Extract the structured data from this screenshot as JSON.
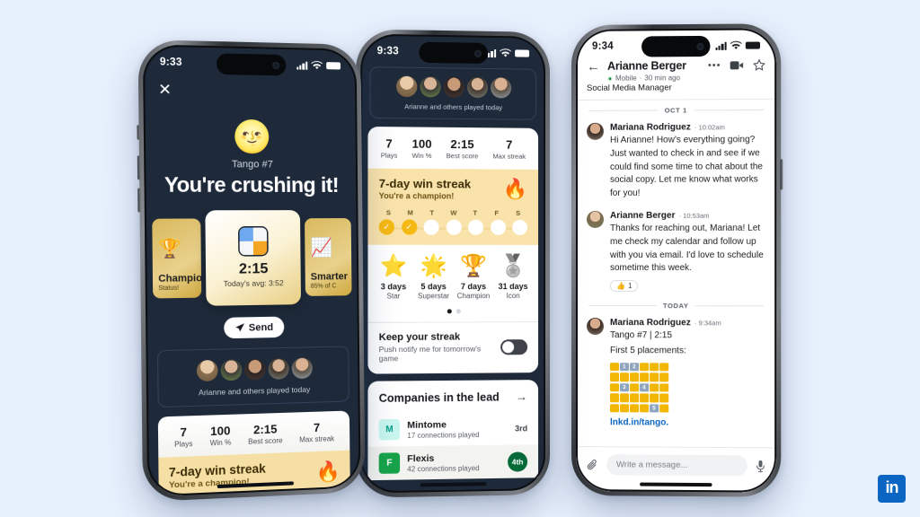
{
  "background_color": "#e7f0fd",
  "brand": {
    "logo_text": "in",
    "logo_color": "#0a66c2"
  },
  "phone1": {
    "status": {
      "time": "9:33",
      "signal_icon": "cellular-bars-icon",
      "wifi_icon": "wifi-icon",
      "battery_icon": "battery-icon"
    },
    "close_icon": "close-icon",
    "hero": {
      "emoji": "🌝",
      "subtitle": "Tango #7",
      "title": "You're crushing it!"
    },
    "cards": [
      {
        "icon": "🏆",
        "title": "Champion",
        "subtitle": "Status!"
      },
      {
        "icon": "tango-grid-icon",
        "value": "2:15",
        "subtitle": "Today's avg: 3:52"
      },
      {
        "icon": "📈",
        "title": "Smarter",
        "subtitle": "85% of C"
      }
    ],
    "send_button": {
      "label": "Send",
      "icon": "send-icon"
    },
    "friends": {
      "caption": "Arianne and others played today",
      "avatar_count": 5
    },
    "stats": [
      {
        "value": "7",
        "label": "Plays"
      },
      {
        "value": "100",
        "label": "Win %"
      },
      {
        "value": "2:15",
        "label": "Best score"
      },
      {
        "value": "7",
        "label": "Max streak"
      }
    ],
    "streak": {
      "title": "7-day win streak",
      "subtitle": "You're a champion!",
      "icon": "flame-icon"
    }
  },
  "phone2": {
    "status": {
      "time": "9:33"
    },
    "friends": {
      "caption": "Arianne and others played today",
      "avatar_count": 5
    },
    "stats": [
      {
        "value": "7",
        "label": "Plays"
      },
      {
        "value": "100",
        "label": "Win %"
      },
      {
        "value": "2:15",
        "label": "Best score"
      },
      {
        "value": "7",
        "label": "Max streak"
      }
    ],
    "streak": {
      "title": "7-day win streak",
      "subtitle": "You're a champion!",
      "icon": "flame-icon",
      "days": [
        {
          "label": "S",
          "done": true
        },
        {
          "label": "M",
          "done": true
        },
        {
          "label": "T",
          "done": false
        },
        {
          "label": "W",
          "done": false
        },
        {
          "label": "T",
          "done": false
        },
        {
          "label": "F",
          "done": false
        },
        {
          "label": "S",
          "done": false
        }
      ]
    },
    "badges": [
      {
        "icon": "⭐",
        "days": "3 days",
        "name": "Star"
      },
      {
        "icon": "🌟",
        "days": "5 days",
        "name": "Superstar"
      },
      {
        "icon": "🏆",
        "days": "7 days",
        "name": "Champion"
      },
      {
        "icon": "🏅",
        "days": "31 days",
        "name": "Icon"
      }
    ],
    "pager": {
      "pages": 2,
      "active": 0
    },
    "notify": {
      "title": "Keep your streak",
      "subtitle": "Push notify me for tomorrow's game",
      "toggle_state": "off"
    },
    "leaderboard": {
      "title": "Companies in the lead",
      "arrow_icon": "arrow-right-icon",
      "rows": [
        {
          "logo_text": "M",
          "logo_color": "#c9f7ef",
          "name": "Mintome",
          "sub": "17 connections played",
          "rank": "3rd"
        },
        {
          "logo_text": "F",
          "logo_color": "#17a34a",
          "name": "Flexis",
          "sub": "42 connections played",
          "rank": "4th"
        }
      ]
    }
  },
  "phone3": {
    "status": {
      "time": "9:34"
    },
    "header": {
      "back_icon": "back-arrow-icon",
      "name": "Arianne Berger",
      "presence": "Mobile",
      "last_seen": "30 min ago",
      "role": "Social Media Manager",
      "more_icon": "more-horizontal-icon",
      "video_icon": "video-camera-icon",
      "star_icon": "star-outline-icon"
    },
    "separators": {
      "first": "OCT 1",
      "second": "TODAY"
    },
    "messages": [
      {
        "sender": "Mariana Rodriguez",
        "time": "10:02am",
        "text": "Hi Arianne! How's everything going? Just wanted to check in and see if we could find some time to chat about the social copy. Let me know what works for you!"
      },
      {
        "sender": "Arianne Berger",
        "time": "10:53am",
        "text": "Thanks for reaching out, Mariana! Let me check my calendar and follow up with you via email. I'd love to schedule sometime this week.",
        "reaction": {
          "emoji": "👍",
          "count": "1"
        }
      },
      {
        "sender": "Mariana Rodriguez",
        "time": "9:34am",
        "line1": "Tango #7 | 2:15",
        "line2": "First 5 placements:",
        "link": "lnkd.in/tango."
      }
    ],
    "tango_grid": {
      "rows": 5,
      "cols": 6,
      "fill_color": "#f2b705",
      "marker_color": "#8fa5bd",
      "markers": [
        {
          "row": 0,
          "col": 1,
          "label": "1"
        },
        {
          "row": 0,
          "col": 2,
          "label": "2"
        },
        {
          "row": 2,
          "col": 1,
          "label": "3"
        },
        {
          "row": 2,
          "col": 3,
          "label": "4"
        },
        {
          "row": 4,
          "col": 4,
          "label": "5"
        }
      ]
    },
    "composer": {
      "attach_icon": "paperclip-icon",
      "placeholder": "Write a message...",
      "mic_icon": "microphone-icon"
    }
  }
}
